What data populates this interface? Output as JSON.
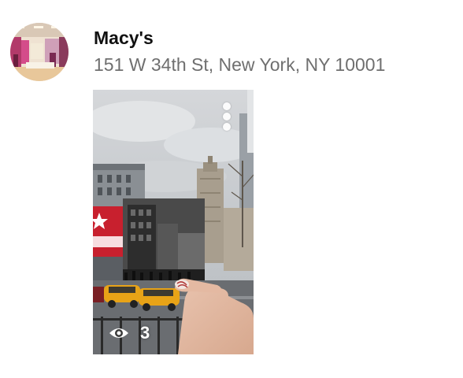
{
  "place": {
    "name": "Macy's",
    "address": "151 W 34th St, New York, NY 10001"
  },
  "story": {
    "view_count": "3",
    "icons": {
      "more": "more-vertical-icon",
      "views": "eye-icon"
    }
  },
  "colors": {
    "name_text": "#111111",
    "address_text": "#6f6f6f",
    "macys_red": "#c8202e",
    "taxi_yellow": "#e8a317"
  }
}
